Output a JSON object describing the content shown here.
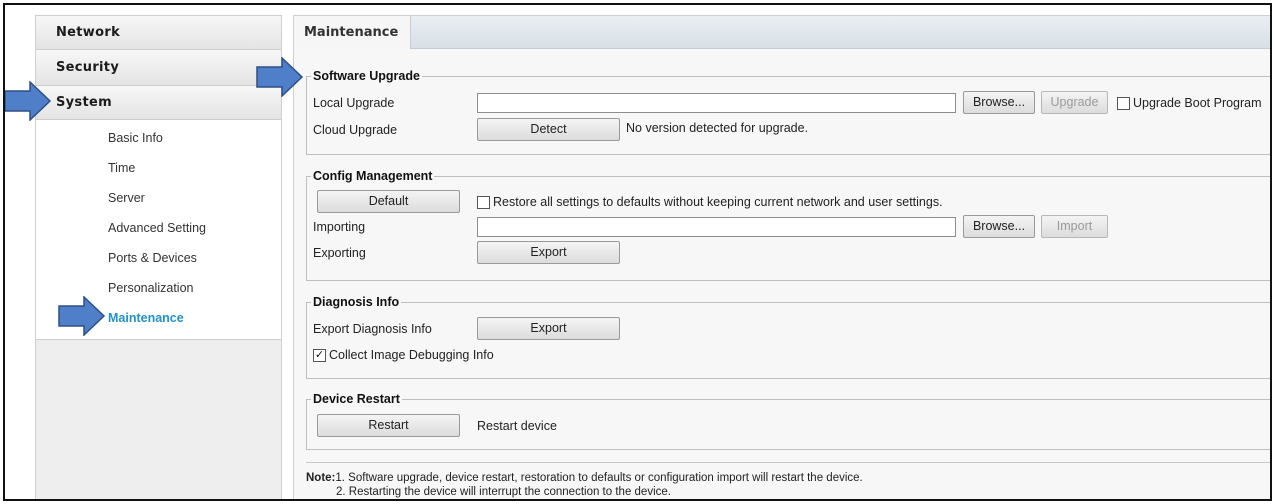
{
  "sidebar": {
    "network": "Network",
    "security": "Security",
    "system": "System",
    "items": [
      "Basic Info",
      "Time",
      "Server",
      "Advanced Setting",
      "Ports & Devices",
      "Personalization",
      "Maintenance"
    ],
    "active_item": "Maintenance"
  },
  "tab": {
    "label": "Maintenance"
  },
  "software_upgrade": {
    "legend": "Software Upgrade",
    "local_label": "Local Upgrade",
    "local_value": "",
    "browse": "Browse...",
    "upgrade": "Upgrade",
    "boot_program_label": "Upgrade Boot Program",
    "boot_program_checked": false,
    "cloud_label": "Cloud Upgrade",
    "detect": "Detect",
    "cloud_status": "No version detected for upgrade."
  },
  "config_management": {
    "legend": "Config Management",
    "default": "Default",
    "restore_label": "Restore all settings to defaults without keeping current network and user settings.",
    "restore_checked": false,
    "importing_label": "Importing",
    "importing_value": "",
    "browse": "Browse...",
    "import": "Import",
    "exporting_label": "Exporting",
    "export": "Export"
  },
  "diagnosis_info": {
    "legend": "Diagnosis Info",
    "export_label": "Export Diagnosis Info",
    "export": "Export",
    "collect_label": "Collect Image Debugging Info",
    "collect_checked": true
  },
  "device_restart": {
    "legend": "Device Restart",
    "restart": "Restart",
    "restart_desc": "Restart device"
  },
  "note": {
    "prefix": "Note:",
    "line1": "1. Software upgrade, device restart, restoration to defaults or configuration import will restart the device.",
    "line2": "2. Restarting the device will interrupt the connection to the device."
  },
  "colors": {
    "arrow_fill": "#4f7fc8",
    "arrow_stroke": "#2e4f86",
    "active_item": "#2293c7"
  }
}
